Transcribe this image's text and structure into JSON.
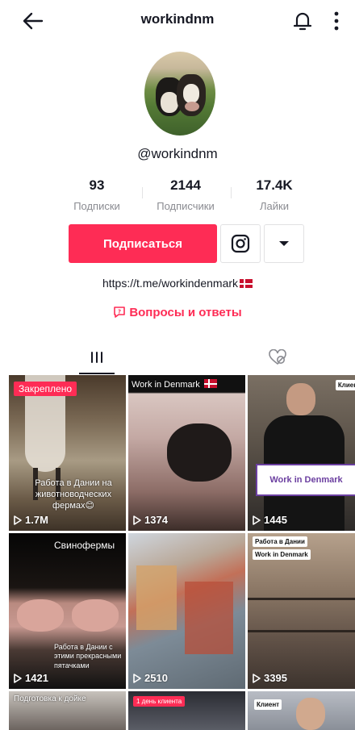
{
  "header": {
    "title": "workindnm"
  },
  "profile": {
    "handle": "@workindnm",
    "stats": [
      {
        "value": "93",
        "label": "Подписки"
      },
      {
        "value": "2144",
        "label": "Подписчики"
      },
      {
        "value": "17.4K",
        "label": "Лайки"
      }
    ],
    "follow_label": "Подписаться",
    "bio_link": "https://t.me/workindenmark",
    "qa_label": "Вопросы и ответы"
  },
  "colors": {
    "accent": "#fe2c55",
    "text": "#161823",
    "muted": "#8a8b91"
  },
  "icons": {
    "back": "arrow-left-icon",
    "bell": "bell-icon",
    "more": "more-vertical-icon",
    "instagram": "instagram-icon",
    "dropdown": "caret-down-icon",
    "grid_tab": "grid-icon",
    "liked_tab": "hidden-heart-icon",
    "views": "play-icon"
  },
  "videos": [
    {
      "views": "1.7M",
      "pinned": "Закреплено",
      "caption": "Работа в Дании на животноводческих фермах😊"
    },
    {
      "views": "1374",
      "tag": "Work in Denmark"
    },
    {
      "views": "1445",
      "tag": "Клиент",
      "sign": "Work in Denmark"
    },
    {
      "views": "1421",
      "title": "Свинофермы",
      "caption": "Работа в Дании с этими прекрасными пятачками"
    },
    {
      "views": "2510"
    },
    {
      "views": "3395",
      "tag": "Работа в Дании",
      "tag2": "Work in Denmark"
    },
    {
      "caption": "Подготовка к дойке"
    },
    {
      "tag": "1 день клиента"
    },
    {
      "tag": "Клиент"
    }
  ]
}
